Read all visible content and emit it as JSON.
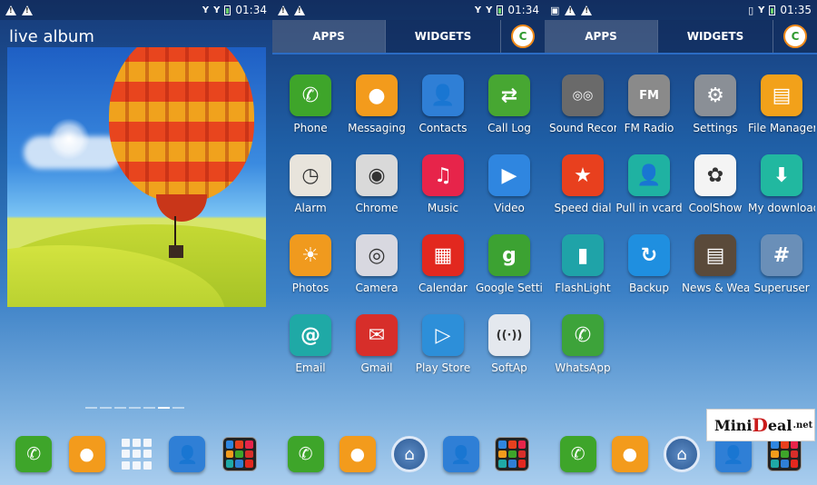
{
  "screen1": {
    "status_time": "01:34",
    "album_label": "live album",
    "dock": [
      "Phone",
      "Messaging",
      "App drawer",
      "Contacts",
      "Folder"
    ]
  },
  "screen2": {
    "status_time": "01:34",
    "tabs": {
      "apps": "APPS",
      "widgets": "WIDGETS"
    },
    "apps": [
      {
        "label": "Phone",
        "icon": "phone-icon",
        "color": "#3ea52a"
      },
      {
        "label": "Messaging",
        "icon": "message-icon",
        "color": "#f39b1c"
      },
      {
        "label": "Contacts",
        "icon": "contacts-icon",
        "color": "#2f7fd6"
      },
      {
        "label": "Call Log",
        "icon": "call-log-icon",
        "color": "#47a732"
      },
      {
        "label": "Alarm",
        "icon": "clock-icon",
        "color": "#e8e4dc"
      },
      {
        "label": "Chrome",
        "icon": "chrome-icon",
        "color": "#d9d9d9"
      },
      {
        "label": "Music",
        "icon": "music-icon",
        "color": "#e7244a"
      },
      {
        "label": "Video",
        "icon": "video-icon",
        "color": "#2f86e0"
      },
      {
        "label": "Photos",
        "icon": "photos-icon",
        "color": "#f09a1e"
      },
      {
        "label": "Camera",
        "icon": "camera-icon",
        "color": "#d8d8e0"
      },
      {
        "label": "Calendar",
        "icon": "calendar-icon",
        "color": "#e2281f"
      },
      {
        "label": "Google Settings",
        "icon": "google-settings-icon",
        "color": "#3ca232"
      },
      {
        "label": "Email",
        "icon": "email-icon",
        "color": "#1fa9a6"
      },
      {
        "label": "Gmail",
        "icon": "gmail-icon",
        "color": "#d72e2a"
      },
      {
        "label": "Play Store",
        "icon": "play-store-icon",
        "color": "#2d8fd9"
      },
      {
        "label": "SoftAp",
        "icon": "softap-icon",
        "color": "#e4e8ee"
      }
    ],
    "dock": [
      "Phone",
      "Messaging",
      "Home",
      "Contacts",
      "Folder"
    ]
  },
  "screen3": {
    "status_time": "01:35",
    "tabs": {
      "apps": "APPS",
      "widgets": "WIDGETS"
    },
    "apps": [
      {
        "label": "Sound Recorder",
        "icon": "recorder-icon",
        "color": "#6a6a6a"
      },
      {
        "label": "FM Radio",
        "icon": "radio-icon",
        "color": "#8a8a8a"
      },
      {
        "label": "Settings",
        "icon": "gear-icon",
        "color": "#8a8f96"
      },
      {
        "label": "File Manager",
        "icon": "file-manager-icon",
        "color": "#f2a11a"
      },
      {
        "label": "Speed dial",
        "icon": "star-icon",
        "color": "#e8401e"
      },
      {
        "label": "Pull in vcard",
        "icon": "vcard-icon",
        "color": "#1fb2a2"
      },
      {
        "label": "CoolShow",
        "icon": "coolshow-icon",
        "color": "#f4f4f4"
      },
      {
        "label": "My downloads",
        "icon": "download-icon",
        "color": "#21b8a0"
      },
      {
        "label": "FlashLight",
        "icon": "flashlight-icon",
        "color": "#1fa3a8"
      },
      {
        "label": "Backup",
        "icon": "backup-icon",
        "color": "#1f8fe0"
      },
      {
        "label": "News & Weather",
        "icon": "news-icon",
        "color": "#5a4a3a"
      },
      {
        "label": "Superuser",
        "icon": "superuser-icon",
        "color": "#6a8fb8"
      },
      {
        "label": "WhatsApp",
        "icon": "whatsapp-icon",
        "color": "#3da33a"
      }
    ],
    "dock": [
      "Phone",
      "Messaging",
      "Home",
      "Contacts",
      "Folder"
    ]
  },
  "watermark": {
    "mini": "Mini",
    "d": "D",
    "eal": "eal",
    "net": ".net"
  }
}
